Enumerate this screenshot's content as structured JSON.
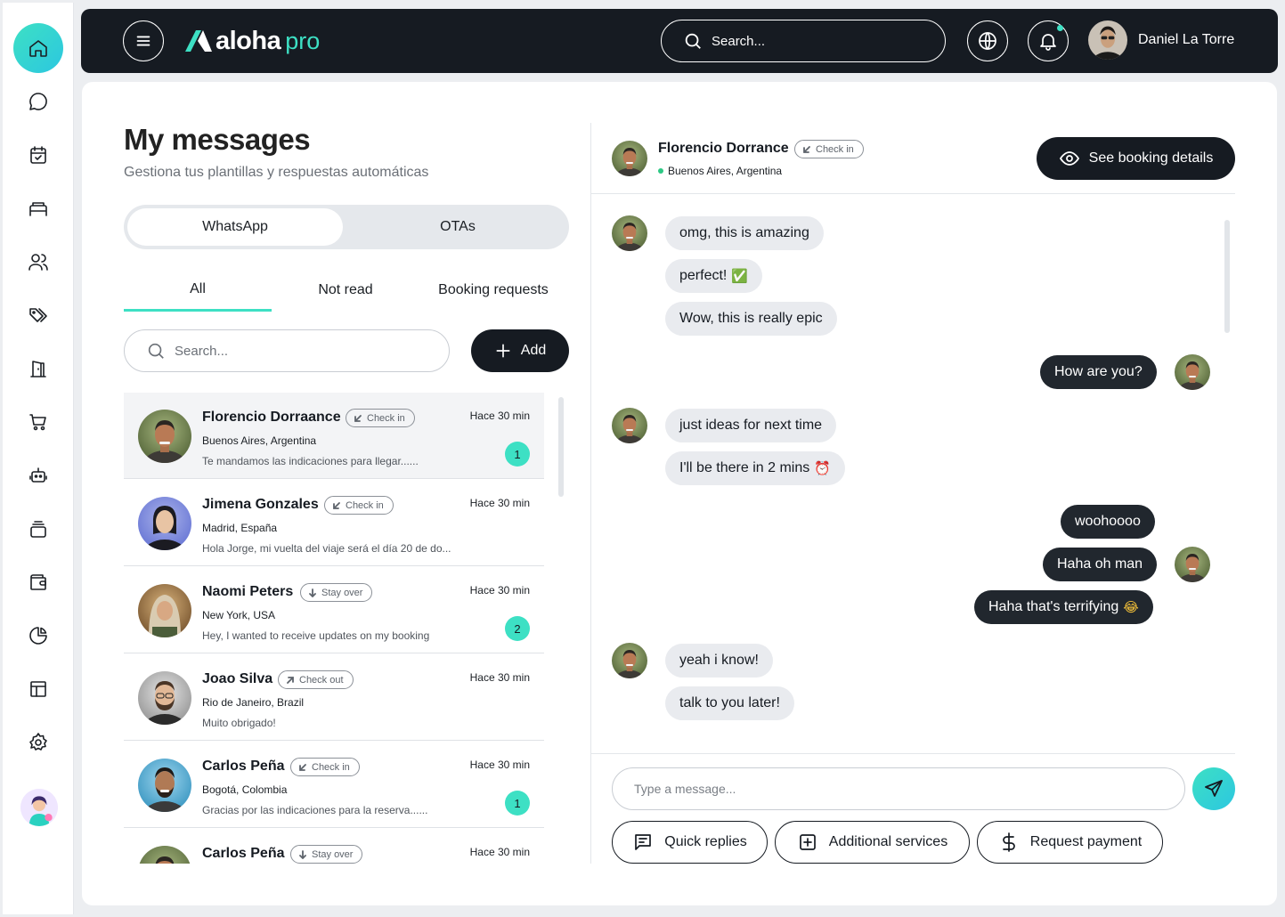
{
  "brand": {
    "name": "aloha",
    "suffix": "pro",
    "accent": "#3de0c4",
    "dark": "#161b22"
  },
  "topbar": {
    "search_placeholder": "Search...",
    "user_name": "Daniel La Torre"
  },
  "sidebar": {
    "items": [
      "home-icon",
      "chat-icon",
      "calendar-icon",
      "bed-icon",
      "users-icon",
      "tags-icon",
      "door-icon",
      "cart-icon",
      "robot-icon",
      "layers-icon",
      "wallet-icon",
      "pie-chart-icon",
      "layout-icon",
      "gear-icon"
    ]
  },
  "page": {
    "title": "My messages",
    "subtitle": "Gestiona tus plantillas y respuestas automáticas"
  },
  "channel_toggle": {
    "options": [
      "WhatsApp",
      "OTAs"
    ],
    "selected": "WhatsApp"
  },
  "filter_tabs": {
    "options": [
      "All",
      "Not read",
      "Booking requests"
    ],
    "selected": "All"
  },
  "list_search": {
    "placeholder": "Search..."
  },
  "add_button": "Add",
  "conversations": [
    {
      "name": "Florencio Dorraance",
      "status": "Check in",
      "time": "Hace 30 min",
      "location": "Buenos Aires, Argentina",
      "preview": "Te mandamos las indicaciones para llegar......",
      "unread": "1"
    },
    {
      "name": "Jimena Gonzales",
      "status": "Check in",
      "time": "Hace 30 min",
      "location": "Madrid, España",
      "preview": "Hola Jorge, mi vuelta del viaje será el día 20 de do...",
      "unread": ""
    },
    {
      "name": "Naomi Peters",
      "status": "Stay over",
      "time": "Hace 30 min",
      "location": "New York, USA",
      "preview": "Hey, I wanted to receive updates on my booking",
      "unread": "2"
    },
    {
      "name": "Joao Silva",
      "status": "Check out",
      "time": "Hace 30 min",
      "location": "Rio de Janeiro, Brazil",
      "preview": "Muito obrigado!",
      "unread": ""
    },
    {
      "name": "Carlos Peña",
      "status": "Check in",
      "time": "Hace 30 min",
      "location": "Bogotá, Colombia",
      "preview": "Gracias por las indicaciones para la reserva......",
      "unread": "1"
    },
    {
      "name": "Carlos Peña",
      "status": "Stay over",
      "time": "Hace 30 min",
      "location": "",
      "preview": "",
      "unread": ""
    }
  ],
  "chat": {
    "contact_name": "Florencio Dorrance",
    "status": "Check in",
    "location": "Buenos Aires, Argentina",
    "booking_button": "See booking details",
    "messages": [
      {
        "dir": "in",
        "text": "omg, this is amazing",
        "emoji": ""
      },
      {
        "dir": "in",
        "text": "perfect!",
        "emoji": "✅"
      },
      {
        "dir": "in",
        "text": "Wow, this is really epic",
        "emoji": ""
      },
      {
        "dir": "out",
        "text": "How are you?",
        "emoji": ""
      },
      {
        "dir": "in",
        "text": "just ideas for next time",
        "emoji": ""
      },
      {
        "dir": "in",
        "text": "I'll be there in 2 mins",
        "emoji": "⏰"
      },
      {
        "dir": "out",
        "text": "woohoooo",
        "emoji": ""
      },
      {
        "dir": "out",
        "text": "Haha oh man",
        "emoji": ""
      },
      {
        "dir": "out",
        "text": "Haha that's terrifying",
        "emoji": "😂"
      },
      {
        "dir": "in",
        "text": "yeah i know!",
        "emoji": ""
      },
      {
        "dir": "in",
        "text": "talk to you later!",
        "emoji": ""
      }
    ],
    "input_placeholder": "Type a message...",
    "actions": [
      "Quick replies",
      "Additional services",
      "Request payment"
    ]
  }
}
